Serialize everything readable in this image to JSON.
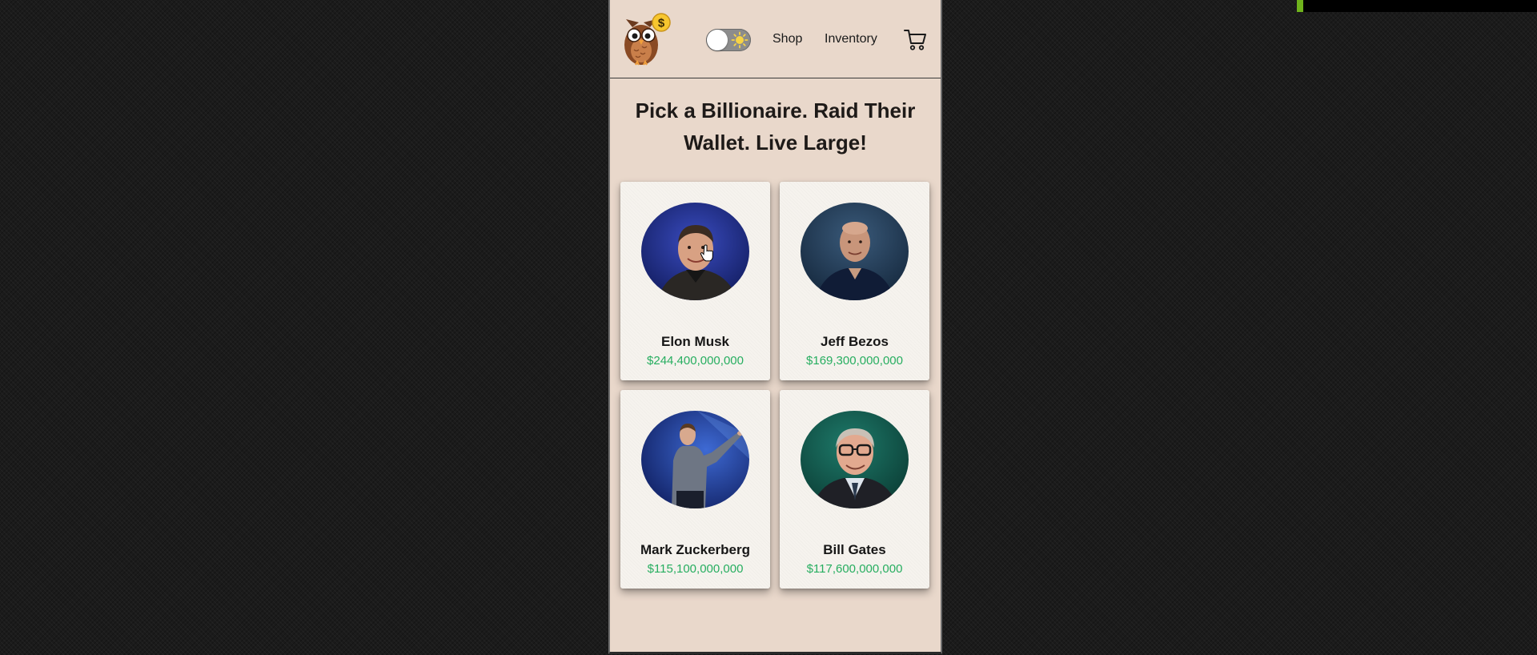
{
  "nav": {
    "links": [
      "Shop",
      "Inventory"
    ]
  },
  "headline": "Pick a Billionaire. Raid Their Wallet. Live Large!",
  "icons": {
    "logo": "owl-money-logo",
    "theme_toggle": "sun-icon",
    "cart": "shopping-cart-icon",
    "cursor": "hand-pointer-icon"
  },
  "colors": {
    "page_background": "#e9d8cb",
    "networth_green": "#27ae60",
    "card_background": "#f6f3ee"
  },
  "billionaires": [
    {
      "name": "Elon Musk",
      "net_worth": "$244,400,000,000"
    },
    {
      "name": "Jeff Bezos",
      "net_worth": "$169,300,000,000"
    },
    {
      "name": "Mark Zuckerberg",
      "net_worth": "$115,100,000,000"
    },
    {
      "name": "Bill Gates",
      "net_worth": "$117,600,000,000"
    }
  ]
}
